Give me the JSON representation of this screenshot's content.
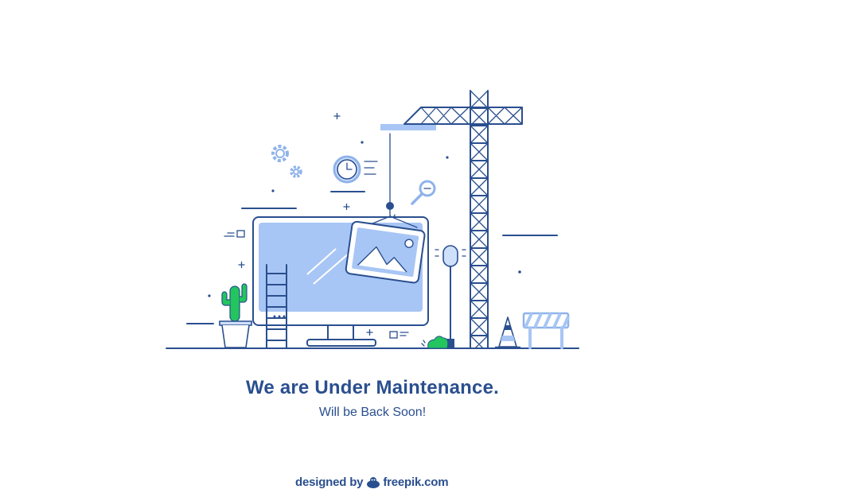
{
  "main": {
    "headline": "We are Under Maintenance.",
    "subline": "Will be Back Soon!"
  },
  "credit": {
    "prefix": "designed by",
    "brand": "freepik.com"
  },
  "illustration": {
    "icons": [
      "gear-icon",
      "clock-icon",
      "magnifier-icon",
      "picture-frame-icon",
      "cactus-icon",
      "ladder-icon",
      "crane-icon",
      "traffic-cone-icon",
      "barrier-icon",
      "lamp-icon",
      "monitor-icon"
    ]
  },
  "colors": {
    "line": "#2a4f8f",
    "fill_light": "#a8c6f5",
    "fill_lighter": "#cfe0fb",
    "green": "#22c55e"
  }
}
